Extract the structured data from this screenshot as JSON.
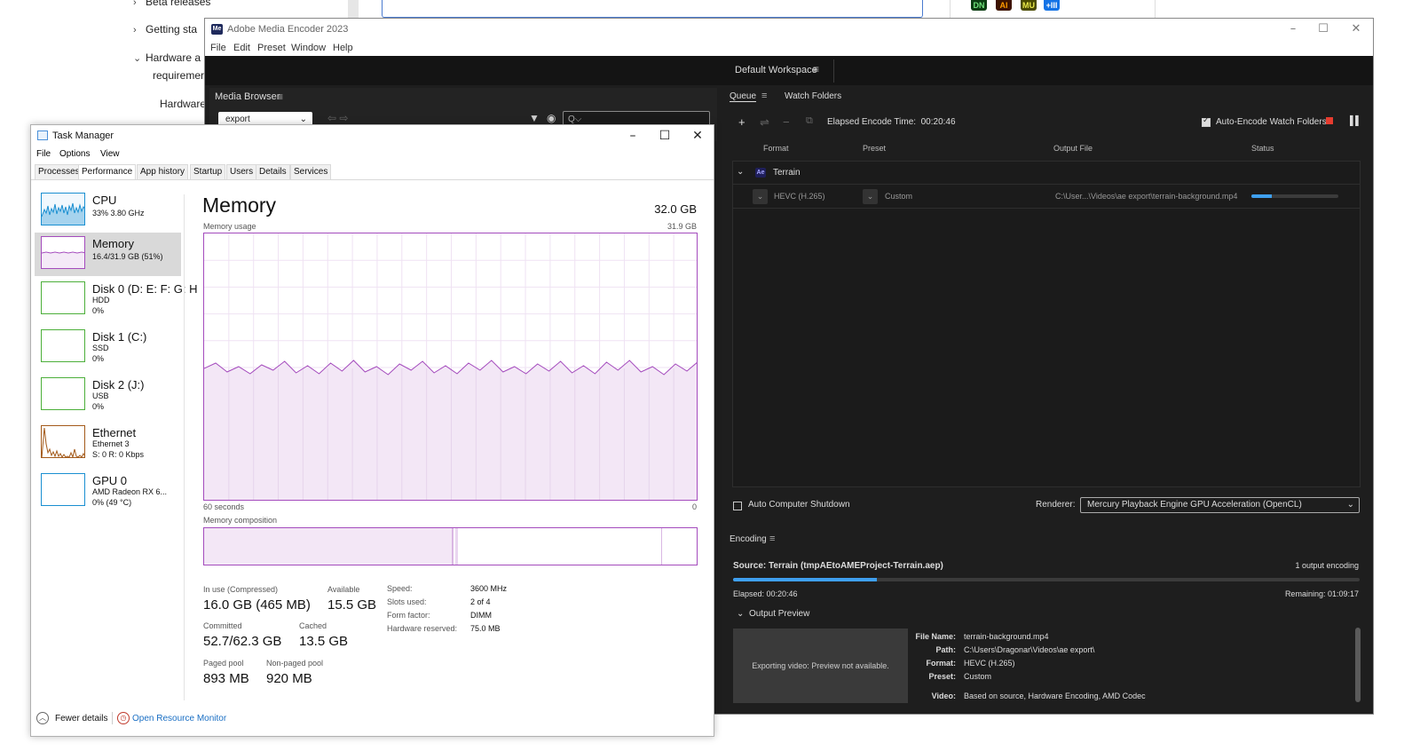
{
  "background": {
    "nav": {
      "beta_releases": "Beta releases",
      "getting_started": "Getting sta",
      "hardware_req_1": "Hardware a",
      "hardware_req_2": "requiremer",
      "hardware": "Hardware"
    },
    "app_icons": [
      "DN",
      "AI",
      "MU",
      "+III"
    ]
  },
  "ame": {
    "title": "Adobe Media Encoder 2023",
    "logo": "Me",
    "menu": [
      "File",
      "Edit",
      "Preset",
      "Window",
      "Help"
    ],
    "workspace": "Default Workspace",
    "media_browser": {
      "title": "Media Browser",
      "folder": "export",
      "search_placeholder": "Q⌵"
    },
    "queue": {
      "tab_queue": "Queue",
      "tab_watch": "Watch Folders",
      "elapsed_label": "Elapsed Encode Time:",
      "elapsed_value": "00:20:46",
      "auto_encode": "Auto-Encode Watch Folders",
      "columns": [
        "Format",
        "Preset",
        "Output File",
        "Status"
      ],
      "group_name": "Terrain",
      "group_icon": "Ae",
      "item": {
        "format": "HEVC (H.265)",
        "preset": "Custom",
        "output": "C:\\User...\\Videos\\ae export\\terrain-background.mp4",
        "progress": 0.23
      },
      "auto_shutdown": "Auto Computer Shutdown",
      "renderer_label": "Renderer:",
      "renderer_value": "Mercury Playback Engine GPU Acceleration (OpenCL)"
    },
    "encoding": {
      "title": "Encoding",
      "source": "Source: Terrain (tmpAEtoAMEProject-Terrain.aep)",
      "output_count": "1 output encoding",
      "elapsed": "Elapsed: 00:20:46",
      "remaining": "Remaining: 01:09:17",
      "progress": 0.23,
      "output_preview": "Output Preview",
      "preview_text": "Exporting video: Preview not available.",
      "meta": [
        {
          "k": "File Name:",
          "v": "terrain-background.mp4"
        },
        {
          "k": "Path:",
          "v": "C:\\Users\\Dragonar\\Videos\\ae export\\"
        },
        {
          "k": "Format:",
          "v": "HEVC (H.265)"
        },
        {
          "k": "Preset:",
          "v": "Custom"
        },
        {
          "k": "Video:",
          "v": "Based on source, Hardware Encoding, AMD Codec"
        }
      ]
    }
  },
  "taskmgr": {
    "title": "Task Manager",
    "menu": [
      "File",
      "Options",
      "View"
    ],
    "tabs": [
      "Processes",
      "Performance",
      "App history",
      "Startup",
      "Users",
      "Details",
      "Services"
    ],
    "sidebar": [
      {
        "name": "CPU",
        "sub1": "33%  3.80 GHz",
        "sub2": "",
        "sub3": ""
      },
      {
        "name": "Memory",
        "sub1": "16.4/31.9 GB (51%)",
        "sub2": "",
        "sub3": ""
      },
      {
        "name": "Disk 0 (D: E: F: G: H",
        "sub1": "HDD",
        "sub2": "0%",
        "sub3": ""
      },
      {
        "name": "Disk 1 (C:)",
        "sub1": "SSD",
        "sub2": "0%",
        "sub3": ""
      },
      {
        "name": "Disk 2 (J:)",
        "sub1": "USB",
        "sub2": "0%",
        "sub3": ""
      },
      {
        "name": "Ethernet",
        "sub1": "Ethernet 3",
        "sub2": "S: 0 R: 0 Kbps",
        "sub3": ""
      },
      {
        "name": "GPU 0",
        "sub1": "AMD Radeon RX 6...",
        "sub2": "0% (49 °C)",
        "sub3": ""
      }
    ],
    "memory": {
      "title": "Memory",
      "total": "32.0 GB",
      "usage_label": "Memory usage",
      "usage_max": "31.9 GB",
      "time_left": "60 seconds",
      "time_right": "0",
      "composition_label": "Memory composition",
      "usage_level": 0.51,
      "in_use_label": "In use (Compressed)",
      "in_use_value": "16.0 GB (465 MB)",
      "available_label": "Available",
      "available_value": "15.5 GB",
      "committed_label": "Committed",
      "committed_value": "52.7/62.3 GB",
      "cached_label": "Cached",
      "cached_value": "13.5 GB",
      "paged_label": "Paged pool",
      "paged_value": "893 MB",
      "nonpaged_label": "Non-paged pool",
      "nonpaged_value": "920 MB",
      "hw": [
        {
          "k": "Speed:",
          "v": "3600 MHz"
        },
        {
          "k": "Slots used:",
          "v": "2 of 4"
        },
        {
          "k": "Form factor:",
          "v": "DIMM"
        },
        {
          "k": "Hardware reserved:",
          "v": "75.0 MB"
        }
      ]
    },
    "footer": {
      "fewer": "Fewer details",
      "monitor": "Open Resource Monitor"
    }
  },
  "colors": {
    "memory_accent": "#a44bbd",
    "cpu_accent": "#1a8fd1",
    "disk_accent": "#4caf3a",
    "ethernet_accent": "#a35a1a",
    "gpu_accent": "#1a8fd1",
    "ame_progress": "#3fa0f0"
  }
}
